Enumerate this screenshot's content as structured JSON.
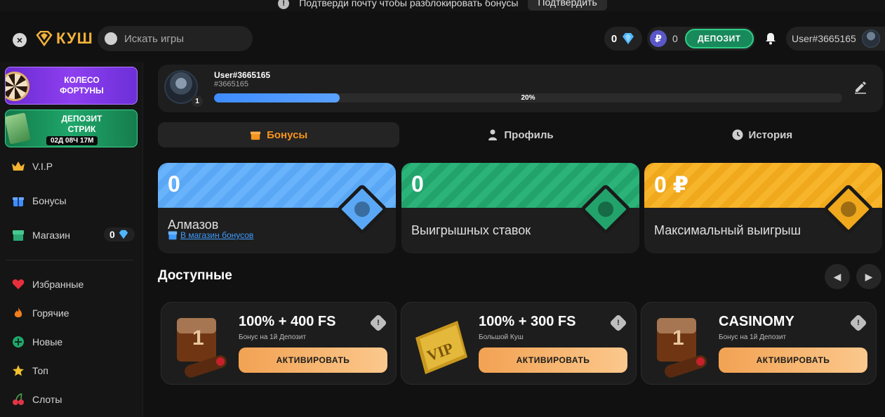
{
  "notice": {
    "text": "Подтверди почту чтобы разблокировать бонусы",
    "button": "Подтвердить"
  },
  "header": {
    "logo_text": "КУШ",
    "search_placeholder": "Искать игры",
    "diamonds": "0",
    "balance": "0",
    "deposit_label": "ДЕПОЗИТ",
    "username": "User#3665165"
  },
  "sidebar": {
    "promos": [
      {
        "line1": "КОЛЕСО",
        "line2": "ФОРТУНЫ"
      },
      {
        "line1": "ДЕПОЗИТ",
        "line2": "СТРИК",
        "timer": "02Д 08Ч 17М"
      }
    ],
    "items": [
      {
        "label": "V.I.P"
      },
      {
        "label": "Бонусы"
      },
      {
        "label": "Магазин",
        "badge": "0"
      },
      {
        "label": "Избранные"
      },
      {
        "label": "Горячие"
      },
      {
        "label": "Новые"
      },
      {
        "label": "Топ"
      },
      {
        "label": "Слоты"
      }
    ]
  },
  "profile": {
    "name": "User#3665165",
    "id": "#3665165",
    "level": "1",
    "progress_percent": 20,
    "progress_label": "20%"
  },
  "tabs": [
    {
      "label": "Бонусы"
    },
    {
      "label": "Профиль"
    },
    {
      "label": "История"
    }
  ],
  "stats": [
    {
      "value": "0",
      "label": "Алмазов",
      "link": "В магазин бонусов",
      "color": "#5aa8f5"
    },
    {
      "value": "0",
      "label": "Выигрышных ставок",
      "color": "#22a36b"
    },
    {
      "value": "0 ₽",
      "label": "Максимальный выигрыш",
      "color": "#f0a81c"
    }
  ],
  "available": {
    "title": "Доступные",
    "offers": [
      {
        "title": "100% + 400 FS",
        "subtitle": "Бонус на 1й Депозит",
        "button": "АКТИВИРОВАТЬ"
      },
      {
        "title": "100% + 300 FS",
        "subtitle": "Большой Куш",
        "button": "АКТИВИРОВАТЬ"
      },
      {
        "title": "CASINOMY",
        "subtitle": "Бонус на 1й Депозит",
        "button": "АКТИВИРОВАТЬ"
      }
    ]
  },
  "colors": {
    "accent": "#f7941d",
    "deposit": "#18895a",
    "progress": "#3f8cff"
  }
}
